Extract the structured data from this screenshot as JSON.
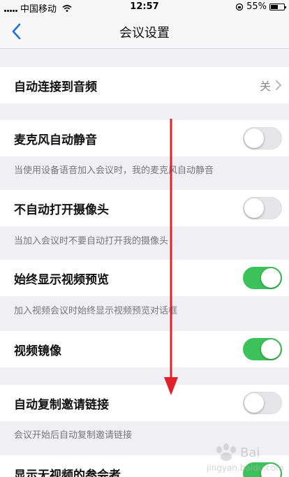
{
  "status_bar": {
    "carrier": "中国移动",
    "time": "12:57",
    "battery": "55%",
    "battery_level": 0.55
  },
  "nav": {
    "title": "会议设置"
  },
  "settings": [
    {
      "label": "自动连接到音频",
      "value": "关"
    },
    {
      "label": "麦克风自动静音",
      "desc": "当使用设备语音加入会议时，我的麦克风自动静音",
      "on": false
    },
    {
      "label": "不自动打开摄像头",
      "desc": "当加入会议时不要自动打开我的摄像头",
      "on": false
    },
    {
      "label": "始终显示视频预览",
      "desc": "加入视频会议时始终显示视频预览对话框",
      "on": true
    },
    {
      "label": "视频镜像",
      "on": true
    },
    {
      "label": "自动复制邀请链接",
      "desc": "会议开始后自动复制邀请链接",
      "on": false
    },
    {
      "label": "显示无视频的参会者",
      "on": true
    }
  ],
  "watermark": {
    "text": "jingyan.baidu.com"
  },
  "colors": {
    "toggle_on": "#3cc25a",
    "back_arrow": "#1e6fd9",
    "annotation_arrow": "#e0202a"
  }
}
